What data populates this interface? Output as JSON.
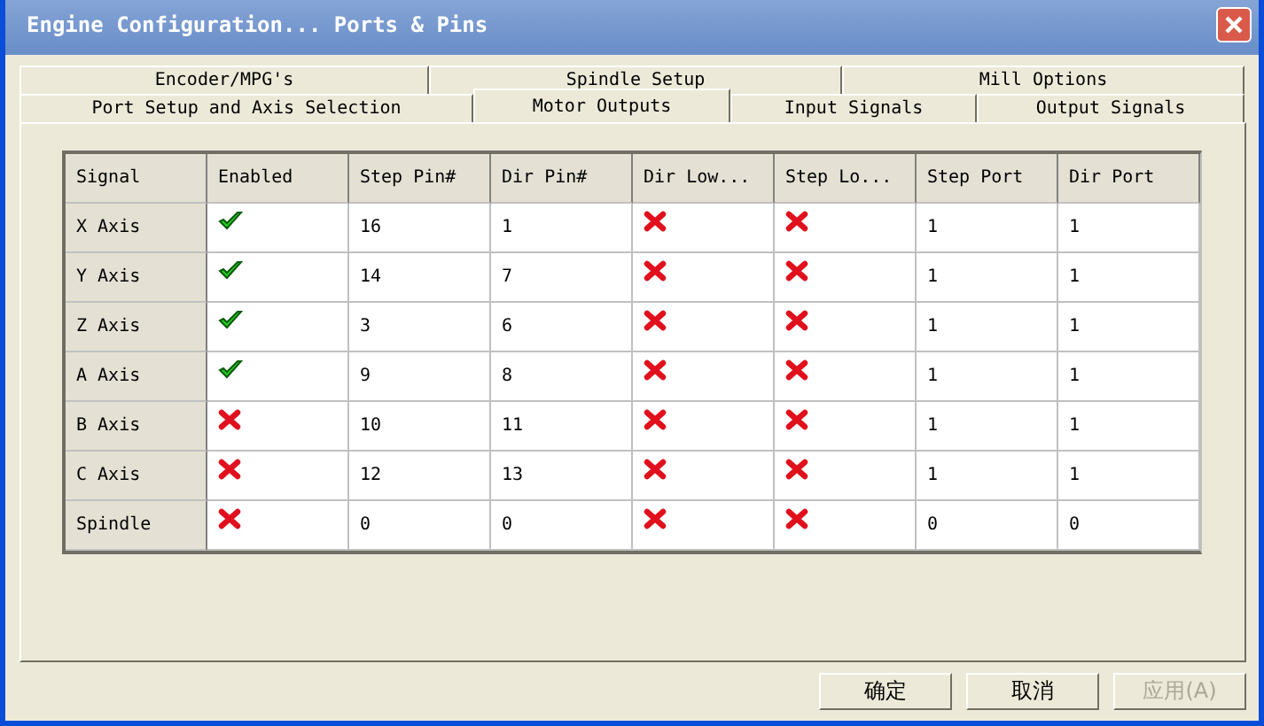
{
  "window": {
    "title": "Engine Configuration... Ports & Pins"
  },
  "tab_rows": [
    {
      "tabs": [
        {
          "label": "Encoder/MPG's",
          "selected": false
        },
        {
          "label": "Spindle Setup",
          "selected": false
        },
        {
          "label": "Mill Options",
          "selected": false
        }
      ]
    },
    {
      "tabs": [
        {
          "label": "Port Setup and Axis Selection",
          "selected": false
        },
        {
          "label": "Motor Outputs",
          "selected": true
        },
        {
          "label": "Input Signals",
          "selected": false
        },
        {
          "label": "Output Signals",
          "selected": false
        }
      ]
    }
  ],
  "table": {
    "columns": [
      "Signal",
      "Enabled",
      "Step Pin#",
      "Dir Pin#",
      "Dir Low...",
      "Step Lo...",
      "Step Port",
      "Dir Port"
    ],
    "rows": [
      {
        "signal": "X Axis",
        "enabled": true,
        "step_pin": "16",
        "dir_pin": "1",
        "dir_low_active": false,
        "step_low_active": false,
        "step_port": "1",
        "dir_port": "1"
      },
      {
        "signal": "Y Axis",
        "enabled": true,
        "step_pin": "14",
        "dir_pin": "7",
        "dir_low_active": false,
        "step_low_active": false,
        "step_port": "1",
        "dir_port": "1"
      },
      {
        "signal": "Z Axis",
        "enabled": true,
        "step_pin": "3",
        "dir_pin": "6",
        "dir_low_active": false,
        "step_low_active": false,
        "step_port": "1",
        "dir_port": "1"
      },
      {
        "signal": "A Axis",
        "enabled": true,
        "step_pin": "9",
        "dir_pin": "8",
        "dir_low_active": false,
        "step_low_active": false,
        "step_port": "1",
        "dir_port": "1"
      },
      {
        "signal": "B Axis",
        "enabled": false,
        "step_pin": "10",
        "dir_pin": "11",
        "dir_low_active": false,
        "step_low_active": false,
        "step_port": "1",
        "dir_port": "1"
      },
      {
        "signal": "C Axis",
        "enabled": false,
        "step_pin": "12",
        "dir_pin": "13",
        "dir_low_active": false,
        "step_low_active": false,
        "step_port": "1",
        "dir_port": "1"
      },
      {
        "signal": "Spindle",
        "enabled": false,
        "step_pin": "0",
        "dir_pin": "0",
        "dir_low_active": false,
        "step_low_active": false,
        "step_port": "0",
        "dir_port": "0"
      }
    ]
  },
  "buttons": [
    {
      "label": "确定",
      "disabled": false
    },
    {
      "label": "取消",
      "disabled": false
    },
    {
      "label": "应用(A)",
      "disabled": true
    }
  ]
}
